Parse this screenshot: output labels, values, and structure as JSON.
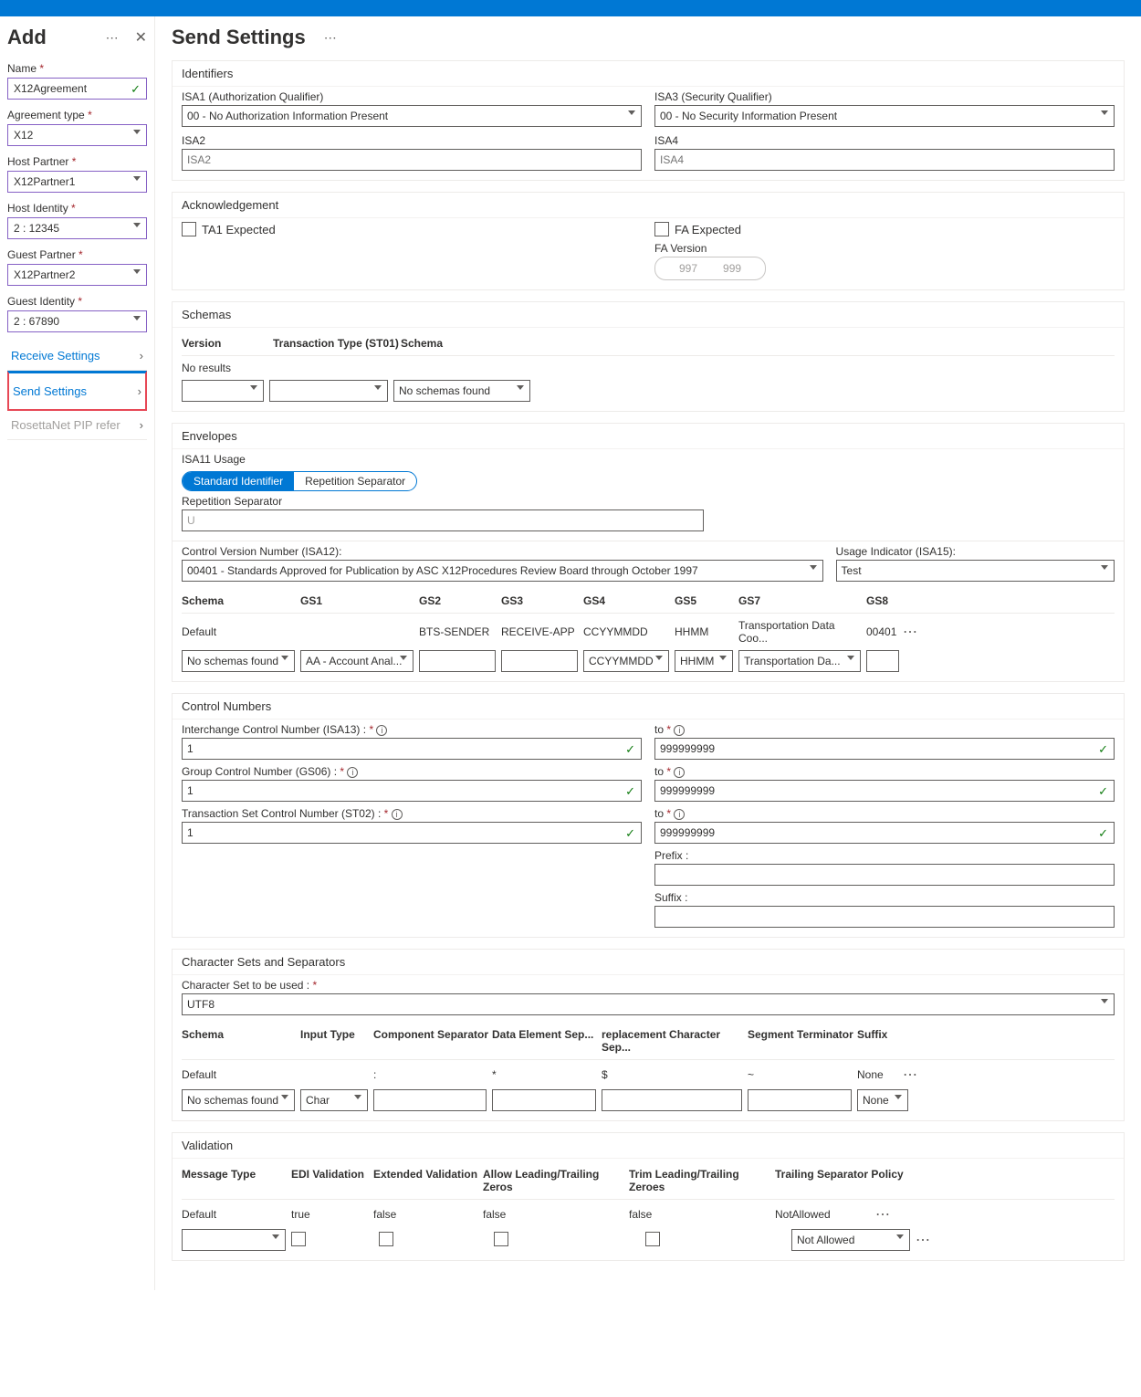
{
  "sidebar": {
    "title": "Add",
    "fields": {
      "name_label": "Name",
      "name_value": "X12Agreement",
      "agreement_type_label": "Agreement type",
      "agreement_type_value": "X12",
      "host_partner_label": "Host Partner",
      "host_partner_value": "X12Partner1",
      "host_identity_label": "Host Identity",
      "host_identity_value": "2 : 12345",
      "guest_partner_label": "Guest Partner",
      "guest_partner_value": "X12Partner2",
      "guest_identity_label": "Guest Identity",
      "guest_identity_value": "2 : 67890"
    },
    "nav": {
      "receive": "Receive Settings",
      "send": "Send Settings",
      "rosetta": "RosettaNet PIP reference"
    }
  },
  "page_title": "Send Settings",
  "identifiers": {
    "title": "Identifiers",
    "isa1_label": "ISA1 (Authorization Qualifier)",
    "isa1_value": "00 - No Authorization Information Present",
    "isa3_label": "ISA3 (Security Qualifier)",
    "isa3_value": "00 - No Security Information Present",
    "isa2_label": "ISA2",
    "isa2_placeholder": "ISA2",
    "isa4_label": "ISA4",
    "isa4_placeholder": "ISA4"
  },
  "ack": {
    "title": "Acknowledgement",
    "ta1": "TA1 Expected",
    "fa": "FA Expected",
    "fa_version_label": "FA Version",
    "v997": "997",
    "v999": "999"
  },
  "schemas": {
    "title": "Schemas",
    "col_version": "Version",
    "col_tt": "Transaction Type (ST01)",
    "col_schema": "Schema",
    "no_results": "No results",
    "no_schemas": "No schemas found"
  },
  "envelopes": {
    "title": "Envelopes",
    "isa11_label": "ISA11 Usage",
    "standard": "Standard Identifier",
    "repetition": "Repetition Separator",
    "rep_sep_label": "Repetition Separator",
    "rep_sep_value": "U",
    "ctrl_version_label": "Control Version Number (ISA12):",
    "ctrl_version_value": "00401 - Standards Approved for Publication by ASC X12Procedures Review Board through October 1997",
    "usage_indicator_label": "Usage Indicator (ISA15):",
    "usage_indicator_value": "Test",
    "cols": {
      "schema": "Schema",
      "gs1": "GS1",
      "gs2": "GS2",
      "gs3": "GS3",
      "gs4": "GS4",
      "gs5": "GS5",
      "gs7": "GS7",
      "gs8": "GS8"
    },
    "default_row": {
      "schema": "Default",
      "gs2": "BTS-SENDER",
      "gs3": "RECEIVE-APP",
      "gs4": "CCYYMMDD",
      "gs5": "HHMM",
      "gs7": "Transportation Data Coo...",
      "gs8": "00401"
    },
    "input_row": {
      "schema": "No schemas found",
      "gs1": "AA - Account Anal...",
      "gs4": "CCYYMMDD",
      "gs5": "HHMM",
      "gs7": "Transportation Da..."
    }
  },
  "control": {
    "title": "Control Numbers",
    "interchange_label": "Interchange Control Number (ISA13) :",
    "group_label": "Group Control Number (GS06) :",
    "transaction_label": "Transaction Set Control Number (ST02) :",
    "to_label": "to",
    "from_value": "1",
    "to_value": "999999999",
    "prefix_label": "Prefix :",
    "suffix_label": "Suffix :"
  },
  "charsets": {
    "title": "Character Sets and Separators",
    "charset_label": "Character Set to be used :",
    "charset_value": "UTF8",
    "cols": {
      "schema": "Schema",
      "input_type": "Input Type",
      "comp": "Component Separator",
      "data": "Data Element Sep...",
      "repl": "replacement Character Sep...",
      "seg": "Segment Terminator",
      "suffix": "Suffix"
    },
    "default_row": {
      "schema": "Default",
      "comp": ":",
      "data": "*",
      "repl": "$",
      "seg": "~",
      "suffix": "None"
    },
    "input_row": {
      "schema": "No schemas found",
      "input_type": "Char",
      "suffix": "None"
    }
  },
  "validation": {
    "title": "Validation",
    "cols": {
      "msg": "Message Type",
      "edi": "EDI Validation",
      "ext": "Extended Validation",
      "lead": "Allow Leading/Trailing Zeros",
      "trim": "Trim Leading/Trailing Zeroes",
      "trail": "Trailing Separator Policy"
    },
    "default_row": {
      "msg": "Default",
      "edi": "true",
      "ext": "false",
      "lead": "false",
      "trim": "false",
      "trail": "NotAllowed"
    },
    "input_row": {
      "trail": "Not Allowed"
    }
  }
}
